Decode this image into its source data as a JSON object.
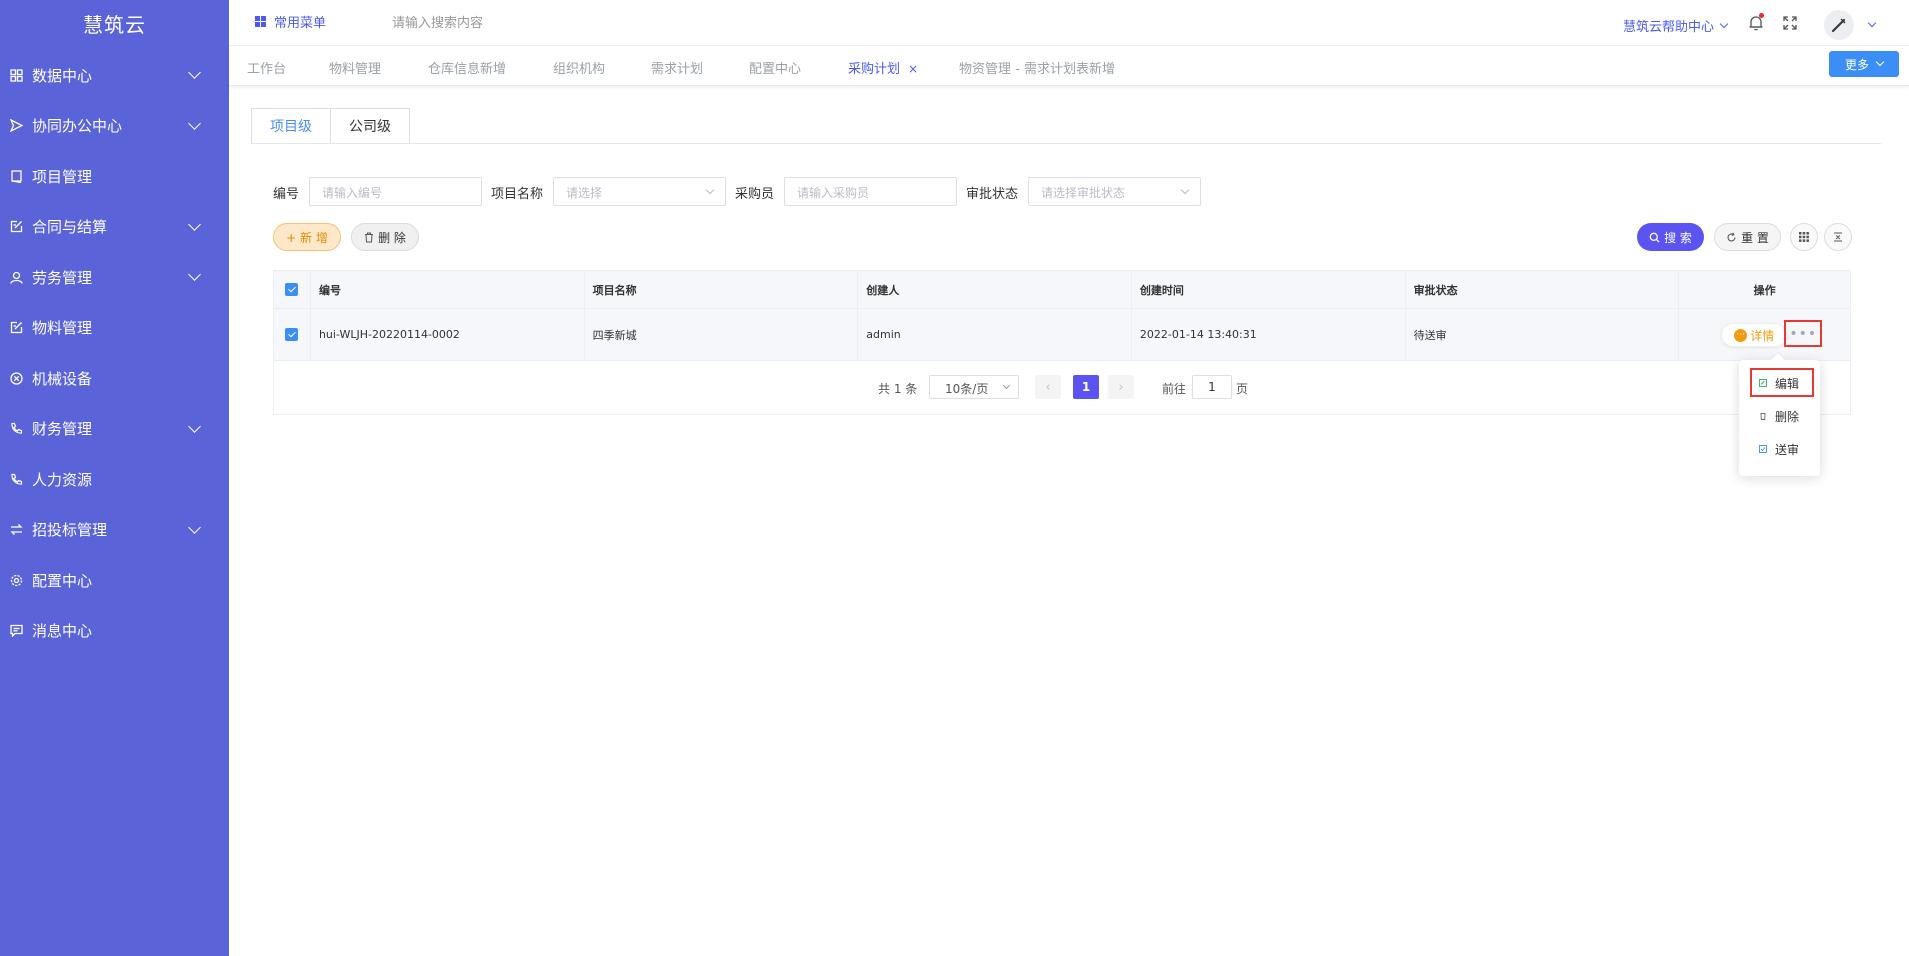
{
  "brand": "慧筑云",
  "sidebar": {
    "items": [
      {
        "label": "数据中心",
        "has_children": true
      },
      {
        "label": "协同办公中心",
        "has_children": true
      },
      {
        "label": "项目管理",
        "has_children": false
      },
      {
        "label": "合同与结算",
        "has_children": true
      },
      {
        "label": "劳务管理",
        "has_children": true
      },
      {
        "label": "物料管理",
        "has_children": false
      },
      {
        "label": "机械设备",
        "has_children": false
      },
      {
        "label": "财务管理",
        "has_children": true
      },
      {
        "label": "人力资源",
        "has_children": false
      },
      {
        "label": "招投标管理",
        "has_children": true
      },
      {
        "label": "配置中心",
        "has_children": false
      },
      {
        "label": "消息中心",
        "has_children": false
      }
    ]
  },
  "topbar": {
    "favorites": "常用菜单",
    "search_placeholder": "请输入搜索内容",
    "help": "慧筑云帮助中心"
  },
  "tags": [
    {
      "label": "工作台",
      "active": false
    },
    {
      "label": "物料管理",
      "active": false
    },
    {
      "label": "仓库信息新增",
      "active": false
    },
    {
      "label": "组织机构",
      "active": false
    },
    {
      "label": "需求计划",
      "active": false
    },
    {
      "label": "配置中心",
      "active": false
    },
    {
      "label": "采购计划",
      "active": true
    },
    {
      "label": "物资管理 - 需求计划表新增",
      "active": false
    }
  ],
  "tags_close": "×",
  "more_label": "更多",
  "tabs": [
    {
      "label": "项目级",
      "active": true
    },
    {
      "label": "公司级",
      "active": false
    }
  ],
  "filters": {
    "code_label": "编号",
    "code_placeholder": "请输入编号",
    "project_label": "项目名称",
    "project_placeholder": "请选择",
    "buyer_label": "采购员",
    "buyer_placeholder": "请输入采购员",
    "status_label": "审批状态",
    "status_placeholder": "请选择审批状态"
  },
  "actions": {
    "add": "+ 新 增",
    "delete": "删 除",
    "search": "搜 索",
    "reset": "重 置"
  },
  "table": {
    "columns": [
      "编号",
      "项目名称",
      "创建人",
      "创建时间",
      "审批状态",
      "操作"
    ],
    "rows": [
      {
        "code": "hui-WLJH-20220114-0002",
        "project": "四季新城",
        "creator": "admin",
        "created": "2022-01-14 13:40:31",
        "status": "待送审"
      }
    ],
    "detail_label": "详情",
    "more_dots": "•••"
  },
  "pagination": {
    "total": "共 1 条",
    "page_size": "10条/页",
    "current_page": "1",
    "goto_label": "前往",
    "goto_value": "1",
    "page_suffix": "页"
  },
  "dropdown": {
    "items": [
      "编辑",
      "删除",
      "送审"
    ]
  },
  "colors": {
    "sidebar_bg": "#5a64d8",
    "primary": "#5b54f0",
    "link": "#4b5bf0",
    "warning": "#f39c12",
    "highlight_border": "#e53935"
  }
}
